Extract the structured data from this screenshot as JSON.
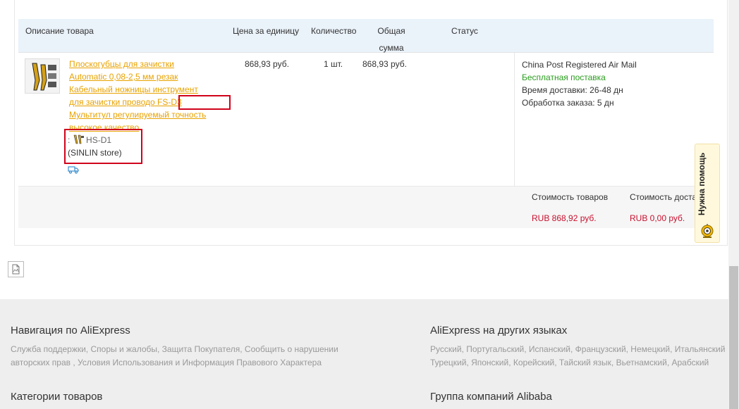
{
  "table": {
    "headers": {
      "description": "Описание товара",
      "unit_price": "Цена за единицу",
      "quantity": "Количество",
      "total_line1": "Общая",
      "total_line2": "сумма",
      "status": "Статус"
    }
  },
  "product": {
    "title_lines": [
      "Плоскогубцы для зачистки",
      "Automatic 0,08-2,5 мм резак",
      "Кабельный ножницы инструмент",
      "для зачистки проводо",
      "Мультитул регулируемый точность",
      "высокое качество"
    ],
    "title_code": " FS-D3",
    "sku_prefix": ":",
    "sku": "HS-D1",
    "store": "(SINLIN store)",
    "unit_price": "868,93 руб.",
    "quantity": "1 шт.",
    "total": "868,93 руб."
  },
  "shipping": {
    "method": "China Post Registered Air Mail",
    "free": "Бесплатная поставка",
    "delivery_time": "Время доставки: 26-48 дн",
    "processing": "Обработка заказа: 5 дн"
  },
  "summary": {
    "goods_label": "Стоимость товаров",
    "goods_value": "RUB 868,92 руб.",
    "delivery_label": "Стоимость доставки",
    "delivery_value": "RUB 0,00 руб."
  },
  "help": {
    "label": "Нужна помощь"
  },
  "footer": {
    "nav_title": "Навигация по AliExpress",
    "nav_links_line1": "Служба поддержки, Споры и жалобы, Защита Покупателя, Сообщить о нарушении",
    "nav_links_line2": "авторских прав , Условия Использования и Информация Правового Характера",
    "lang_title": "AliExpress на других языках",
    "lang_links_line1": "Русский, Португальский, Испанский, Французский, Немецкий, Итальянский",
    "lang_links_line2": "Турецкий, Японский, Корейский, Тайский язык, Вьетнамский, Арабский",
    "categories_title": "Категории товаров",
    "group_title": "Группа компаний Alibaba"
  },
  "colors": {
    "link_orange": "#e8a200",
    "price_red": "#c8102e",
    "free_green": "#2a9d1e",
    "header_blue": "#eaf2fa",
    "highlight_red": "#d0021b"
  }
}
